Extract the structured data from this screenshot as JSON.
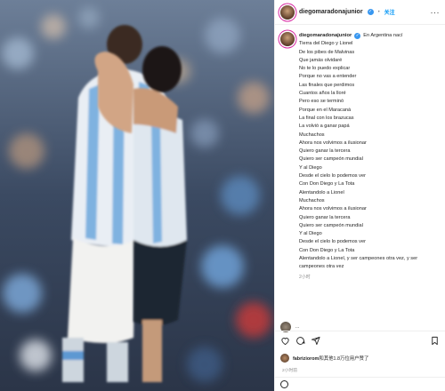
{
  "post": {
    "username": "diegomaradonajunior",
    "follow_dot": "•",
    "follow_label": "关注",
    "more_label": "···"
  },
  "caption": {
    "location_line": "En Argentina nací",
    "lines": [
      "Tierra del Diego y Lionel",
      "De los pibes de Malvinas",
      "Que jamás olvidaré",
      "No te lo puedo explicar",
      "Porque no vas a entender",
      "Las finales que perdimos",
      "Cuantos años la lloré",
      "Pero eso se terminó",
      "Porque en el Maracaná",
      "La final con los brazucas",
      "La volvió a ganar papá",
      "Muchachos",
      "Ahora nos volvimos a ilusionar",
      "Quiero ganar la tercera",
      "Quiero ser campeón mundial",
      "Y al Diego",
      "Desde el cielo lo podemos ver",
      "Con Don Diego y La Tota",
      "Alentandolo a Lionel",
      "Muchachos",
      "Ahora nos volvimos a ilusionar",
      "Quiero ganar la tercera",
      "Quiero ser campeón mundial",
      "Y al Diego",
      "Desde el cielo lo podemos ver",
      "Con Don Diego y La Tota",
      "Alentandolo a Lionel, y ser campeones otra vez, y ser campeones otra vez"
    ],
    "time": "2小时"
  },
  "reply": {
    "text": "..."
  },
  "likes": {
    "user": "fabriziorom",
    "rest": "和其他1.8万位用户赞了"
  },
  "post_time": "2小时前",
  "colors": {
    "accent": "#0095f6",
    "verified": "#3897f0",
    "text": "#262626",
    "muted": "#8e8e8e"
  },
  "icons": [
    "heart-icon",
    "comment-icon",
    "share-icon",
    "bookmark-icon",
    "emoji-icon",
    "verified-icon",
    "more-icon"
  ]
}
